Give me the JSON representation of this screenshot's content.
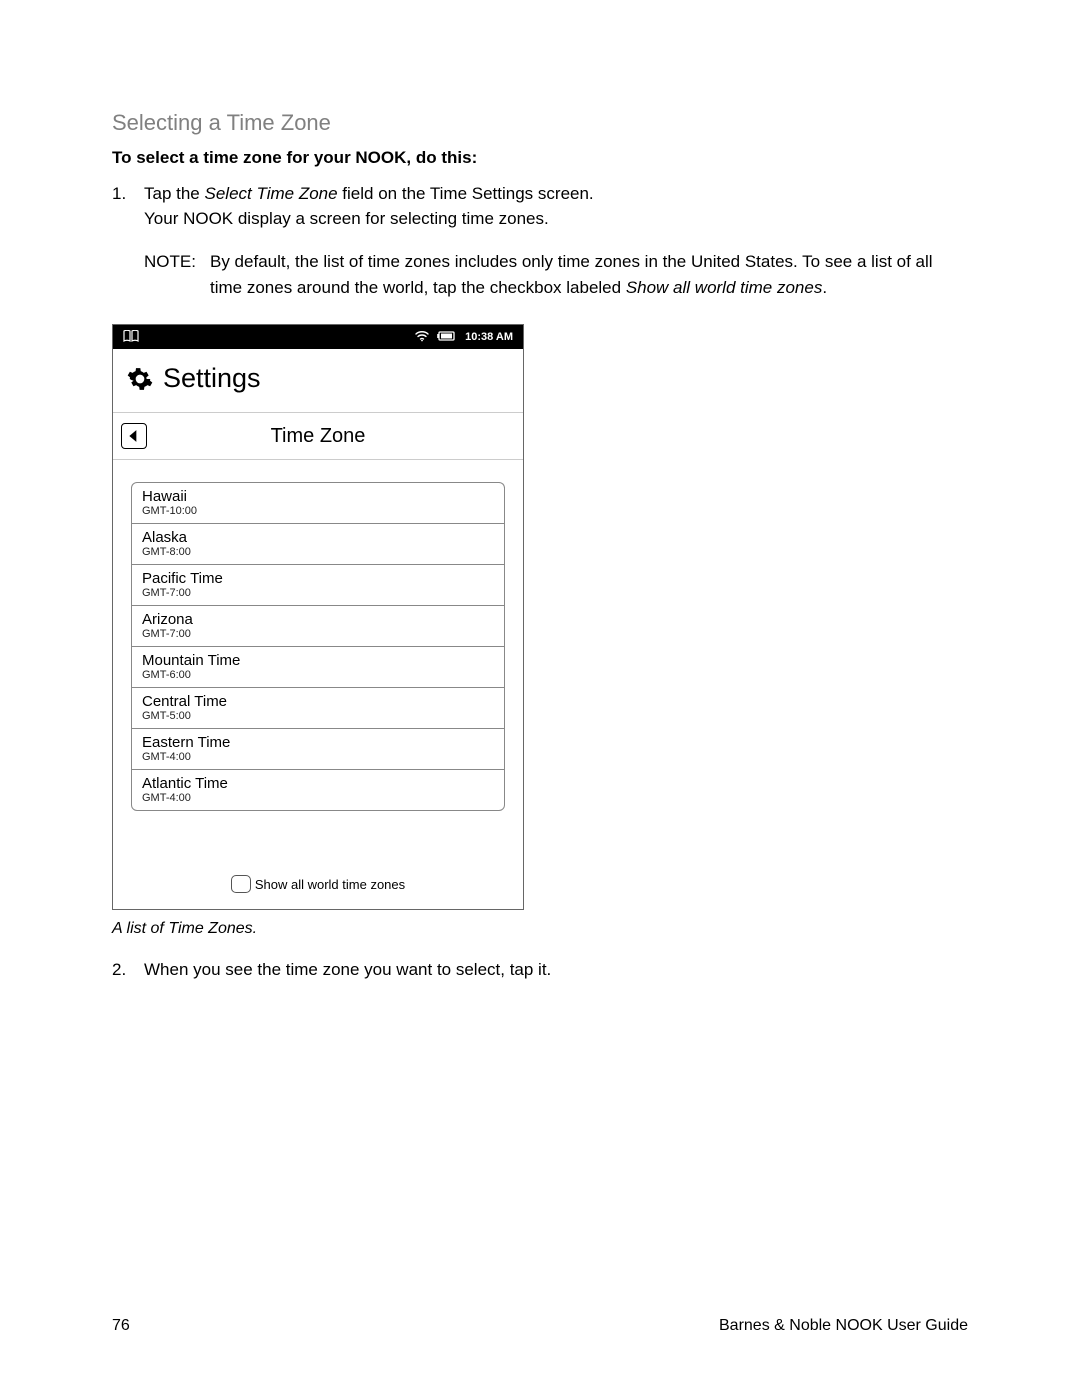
{
  "heading": "Selecting a Time Zone",
  "intro_bold": "To select a time zone for your NOOK, do this:",
  "step1_num": "1.",
  "step1_a": "Tap the ",
  "step1_italic": "Select Time Zone",
  "step1_b": " field on the Time Settings screen.",
  "step1_line2": "Your NOOK display a screen for selecting time zones.",
  "note_label": "NOTE:",
  "note_a": "By default, the list of time zones includes only time zones in the United States. To see a list of all time zones around the world, tap the checkbox labeled ",
  "note_italic": "Show all world time zones",
  "note_b": ".",
  "caption": "A list of Time Zones.",
  "step2_num": "2.",
  "step2": "When you see the time zone you want to select, tap it.",
  "footer_page": "76",
  "footer_right": "Barnes & Noble NOOK User Guide",
  "device": {
    "status_time": "10:38 AM",
    "settings_title": "Settings",
    "subheader_title": "Time Zone",
    "show_all_label": "Show all world time zones",
    "timezones": [
      {
        "name": "Hawaii",
        "gmt": "GMT-10:00"
      },
      {
        "name": "Alaska",
        "gmt": "GMT-8:00"
      },
      {
        "name": "Pacific Time",
        "gmt": "GMT-7:00"
      },
      {
        "name": "Arizona",
        "gmt": "GMT-7:00"
      },
      {
        "name": "Mountain Time",
        "gmt": "GMT-6:00"
      },
      {
        "name": "Central Time",
        "gmt": "GMT-5:00"
      },
      {
        "name": "Eastern Time",
        "gmt": "GMT-4:00"
      },
      {
        "name": "Atlantic Time",
        "gmt": "GMT-4:00"
      }
    ]
  }
}
